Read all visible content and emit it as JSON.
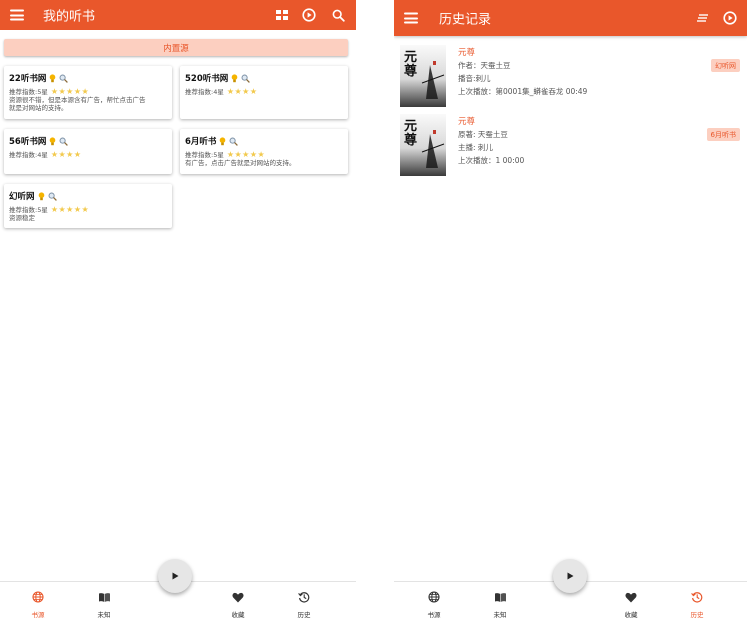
{
  "left": {
    "title": "我的听书",
    "source_label": "内置源",
    "cards": [
      {
        "name": "22听书网",
        "meta": "推荐指数:5星",
        "stars": 5,
        "desc": [
          "资源很不错，但是本源含有广告，帮忙点击广告",
          "就是对网站的支持。"
        ]
      },
      {
        "name": "520听书网",
        "meta": "推荐指数:4星",
        "stars": 4,
        "desc": []
      },
      {
        "name": "56听书网",
        "meta": "推荐指数:4星",
        "stars": 4,
        "desc": []
      },
      {
        "name": "6月听书",
        "meta": "推荐指数:5星",
        "stars": 5,
        "desc": [
          "有广告，点击广告就是对网站的支持。"
        ]
      },
      {
        "name": "幻听网",
        "meta": "推荐指数:5星",
        "stars": 5,
        "desc": [
          "资源稳定"
        ]
      }
    ],
    "nav": [
      {
        "label": "书源",
        "icon": "globe-icon",
        "active": true
      },
      {
        "label": "未知",
        "icon": "book-icon",
        "active": false
      },
      {
        "label": "收藏",
        "icon": "heart-icon",
        "active": false
      },
      {
        "label": "历史",
        "icon": "history-icon",
        "active": false
      }
    ]
  },
  "right": {
    "title": "历史记录",
    "items": [
      {
        "title": "元尊",
        "line1": "作者：天蚕土豆",
        "line2": "播音:刺儿",
        "line3": "上次播放：第0001集_蟒雀吞龙 00:49",
        "badge": "幻听网",
        "cover_text": "元尊"
      },
      {
        "title": "元尊",
        "line1": "原著: 天蚕土豆",
        "line2": "主播: 刺儿",
        "line3": "上次播放：1 00:00",
        "badge": "6月听书",
        "cover_text": "元尊"
      }
    ],
    "nav": [
      {
        "label": "书源",
        "icon": "globe-icon",
        "active": false
      },
      {
        "label": "未知",
        "icon": "book-icon",
        "active": false
      },
      {
        "label": "收藏",
        "icon": "heart-icon",
        "active": false
      },
      {
        "label": "历史",
        "icon": "history-icon",
        "active": true
      }
    ]
  },
  "colors": {
    "accent": "#e9572b",
    "accent_light": "#fccfc0",
    "star": "#f2c94c"
  }
}
